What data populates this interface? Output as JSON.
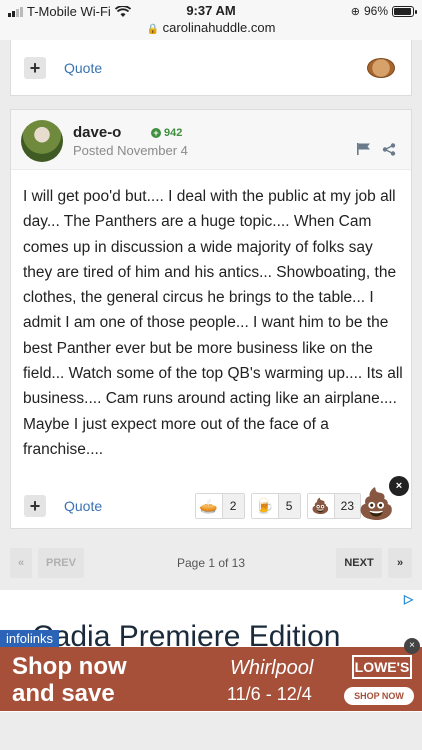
{
  "status_bar": {
    "carrier": "T-Mobile Wi-Fi",
    "time": "9:37 AM",
    "url": "carolinahuddle.com",
    "battery": "96%",
    "battery_level": 0.96
  },
  "previous_post": {
    "quote_label": "Quote",
    "reaction_icon": "pie-icon"
  },
  "post": {
    "username": "dave-o",
    "reputation": "942",
    "posted": "Posted November 4",
    "body": "I will get poo'd but....   I deal with the public at my job all day...  The Panthers are a huge topic....  When Cam comes up in discussion a wide majority of folks say they are tired of him and his antics... Showboating, the clothes, the general circus he brings to the table...  I admit I am one of those people...  I want him to be the best Panther ever but be more business like on the field...  Watch some of the top QB's warming up....  Its all business....  Cam runs around acting like an airplane....  Maybe I just expect more out of the face of a franchise....",
    "quote_label": "Quote",
    "reactions": [
      {
        "icon": "pie-icon",
        "glyph": "🥧",
        "count": "2"
      },
      {
        "icon": "beer-icon",
        "glyph": "🍺",
        "count": "5"
      },
      {
        "icon": "poop-icon",
        "glyph": "💩",
        "count": "23"
      }
    ],
    "big_reaction_glyph": "💩",
    "close_glyph": "×"
  },
  "pagination": {
    "first": "«",
    "prev": "PREV",
    "label": "Page 1 of 13",
    "next": "NEXT",
    "last": "»"
  },
  "ad": {
    "edition_text": "Cadia Premiere Edition",
    "infolinks": "infolinks",
    "headline_line1": "Shop now",
    "headline_line2": "and save",
    "brand": "Whirlpool",
    "dates": "11/6 - 12/4",
    "retailer": "LOWE'S",
    "cta": "SHOP NOW",
    "close_glyph": "×",
    "adchoices_glyph": "▷"
  }
}
